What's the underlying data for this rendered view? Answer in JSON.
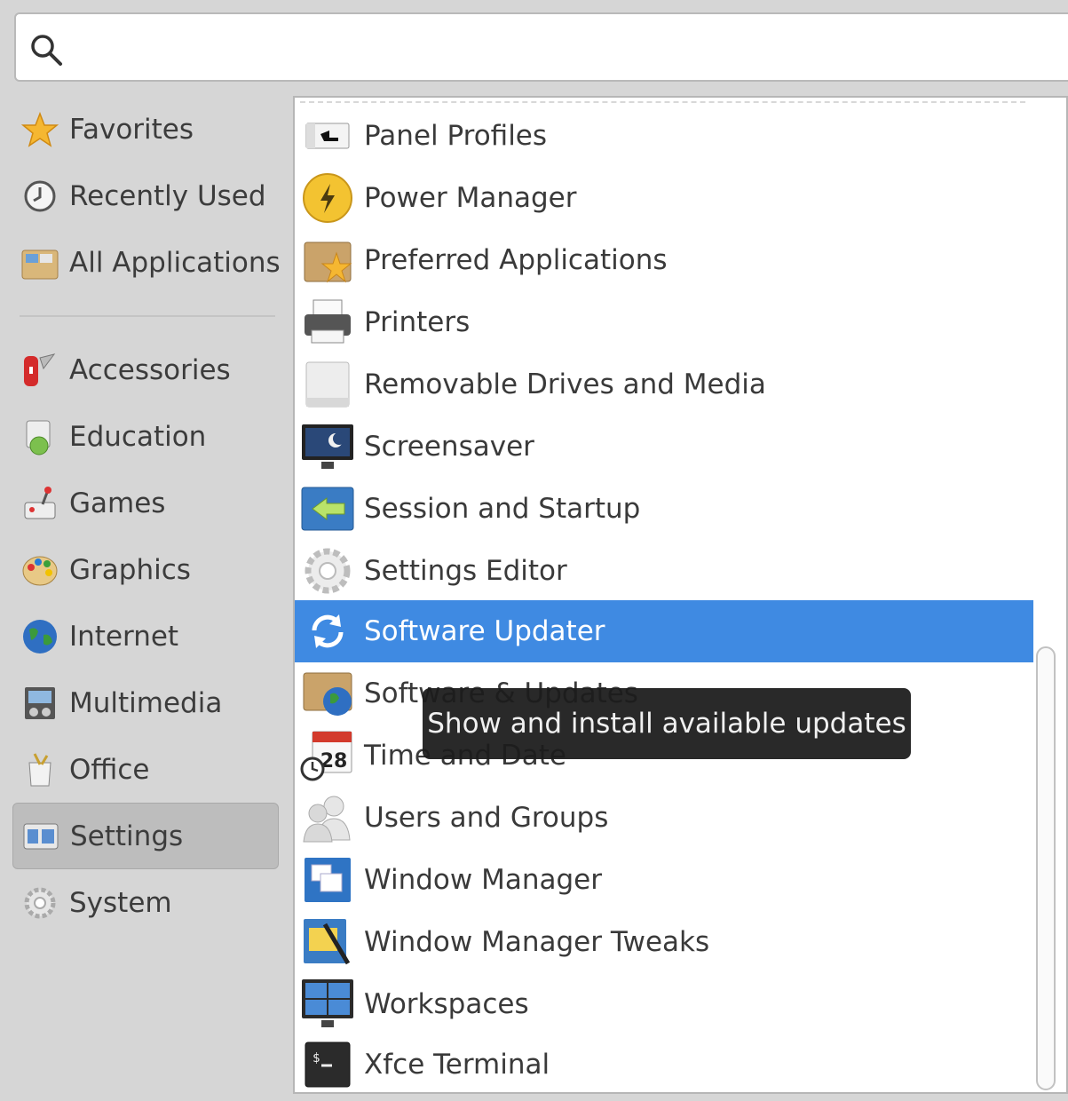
{
  "search": {
    "value": "",
    "placeholder": ""
  },
  "categories": [
    {
      "label": "Favorites",
      "icon": "star-icon"
    },
    {
      "label": "Recently Used",
      "icon": "clock-icon"
    },
    {
      "label": "All Applications",
      "icon": "folder-icon"
    },
    {
      "label": "Accessories",
      "icon": "knife-icon"
    },
    {
      "label": "Education",
      "icon": "flask-icon"
    },
    {
      "label": "Games",
      "icon": "joystick-icon"
    },
    {
      "label": "Graphics",
      "icon": "palette-icon"
    },
    {
      "label": "Internet",
      "icon": "globe-icon"
    },
    {
      "label": "Multimedia",
      "icon": "media-icon"
    },
    {
      "label": "Office",
      "icon": "briefcase-icon"
    },
    {
      "label": "Settings",
      "icon": "settings-panel-icon",
      "active": true
    },
    {
      "label": "System",
      "icon": "gear-icon"
    }
  ],
  "apps": [
    {
      "label": "Panel Profiles",
      "icon": "panel-profiles-icon"
    },
    {
      "label": "Power Manager",
      "icon": "power-icon"
    },
    {
      "label": "Preferred Applications",
      "icon": "preferred-apps-icon"
    },
    {
      "label": "Printers",
      "icon": "printer-icon"
    },
    {
      "label": "Removable Drives and Media",
      "icon": "drive-icon"
    },
    {
      "label": "Screensaver",
      "icon": "screensaver-icon"
    },
    {
      "label": "Session and Startup",
      "icon": "session-icon"
    },
    {
      "label": "Settings Editor",
      "icon": "gear-icon"
    },
    {
      "label": "Software Updater",
      "icon": "refresh-icon",
      "selected": true
    },
    {
      "label": "Software & Updates",
      "icon": "software-updates-icon"
    },
    {
      "label": "Time and Date",
      "icon": "calendar-icon"
    },
    {
      "label": "Users and Groups",
      "icon": "users-icon"
    },
    {
      "label": "Window Manager",
      "icon": "window-manager-icon"
    },
    {
      "label": "Window Manager Tweaks",
      "icon": "window-tweaks-icon"
    },
    {
      "label": "Workspaces",
      "icon": "workspaces-icon"
    },
    {
      "label": "Xfce Terminal",
      "icon": "terminal-icon"
    }
  ],
  "tooltip": {
    "text": "Show and install available updates"
  },
  "calendar_day": "28",
  "colors": {
    "selection": "#3f8ae2",
    "tooltip_bg": "#1c1c1c"
  }
}
